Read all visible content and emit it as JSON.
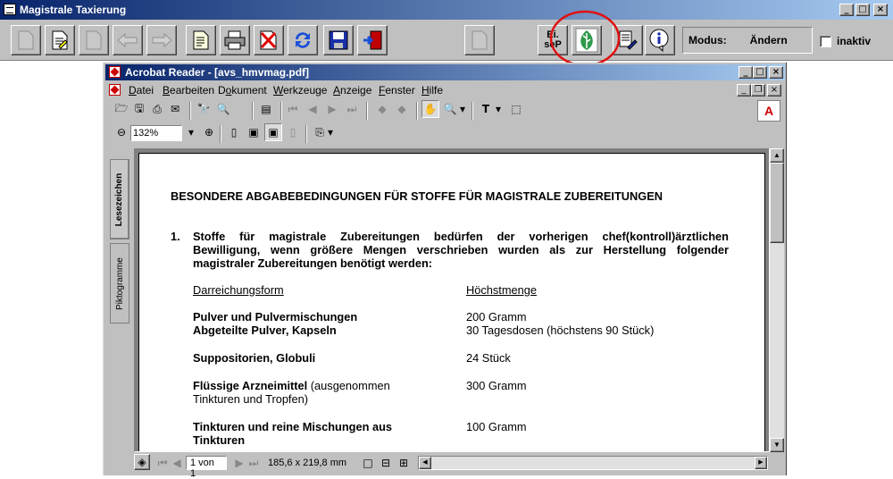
{
  "app": {
    "title": "Magistrale Taxierung",
    "toolbar": {
      "icons": [
        "blank-page-icon",
        "edit-document-icon",
        "blank-page-icon",
        "arrow-left-icon",
        "arrow-right-icon",
        "document-icon",
        "printer-icon",
        "delete-icon",
        "refresh-icon",
        "save-disk-icon",
        "exit-door-icon",
        "blank-page-icon",
        "ei-sep-icon",
        "leaf-icon",
        "edit-list-icon",
        "info-icon"
      ],
      "ei_sep_label": "Ei.\nseP",
      "modus_label": "Modus:",
      "modus_value": "Ändern",
      "inaktiv_label": "inaktiv"
    }
  },
  "acrobat": {
    "title": "Acrobat Reader - [avs_hmvmag.pdf]",
    "menu": [
      "Datei",
      "Bearbeiten",
      "Dokument",
      "Werkzeuge",
      "Anzeige",
      "Fenster",
      "Hilfe"
    ],
    "menu_underline": [
      "D",
      "B",
      "o",
      "W",
      "A",
      "F",
      "H"
    ],
    "zoom": "132%",
    "tabs": [
      "Lesezeichen",
      "Piktogramme"
    ],
    "status": {
      "page": "1 von 1",
      "size": "185,6 x 219,8 mm"
    }
  },
  "document": {
    "heading": "BESONDERE ABGABEBEDINGUNGEN FÜR STOFFE FÜR MAGISTRALE ZUBEREITUNGEN",
    "item_number": "1.",
    "paragraph_lines": [
      "Stoffe für magistrale Zubereitungen bedürfen der vorherigen chef(kontroll)ärztlichen",
      "Bewilligung, wenn größere Mengen verschrieben wurden als zur Herstellung folgender",
      "magistraler Zubereitungen benötigt werden:"
    ],
    "col_form": "Darreichungsform",
    "col_max": "Höchstmenge",
    "rows": [
      {
        "form": "Pulver und Pulvermischungen",
        "max": "200 Gramm"
      },
      {
        "form": "Abgeteilte Pulver, Kapseln",
        "max": "30 Tagesdosen (höchstens 90 Stück)"
      },
      {
        "form": "Suppositorien, Globuli",
        "max": "24 Stück"
      },
      {
        "form": "Flüssige Arzneimittel",
        "form_extra": "(ausgenommen",
        "form_line2": "Tinkturen und Tropfen)",
        "max": "300 Gramm"
      },
      {
        "form": "Tinkturen und reine Mischungen aus",
        "form_line2": "Tinkturen",
        "max": "100 Gramm"
      }
    ]
  },
  "colors": {
    "titlebar_start": "#08246b",
    "titlebar_end": "#a6caf0",
    "highlight_circle": "#e01010",
    "leaf_green": "#2e9a4a"
  }
}
